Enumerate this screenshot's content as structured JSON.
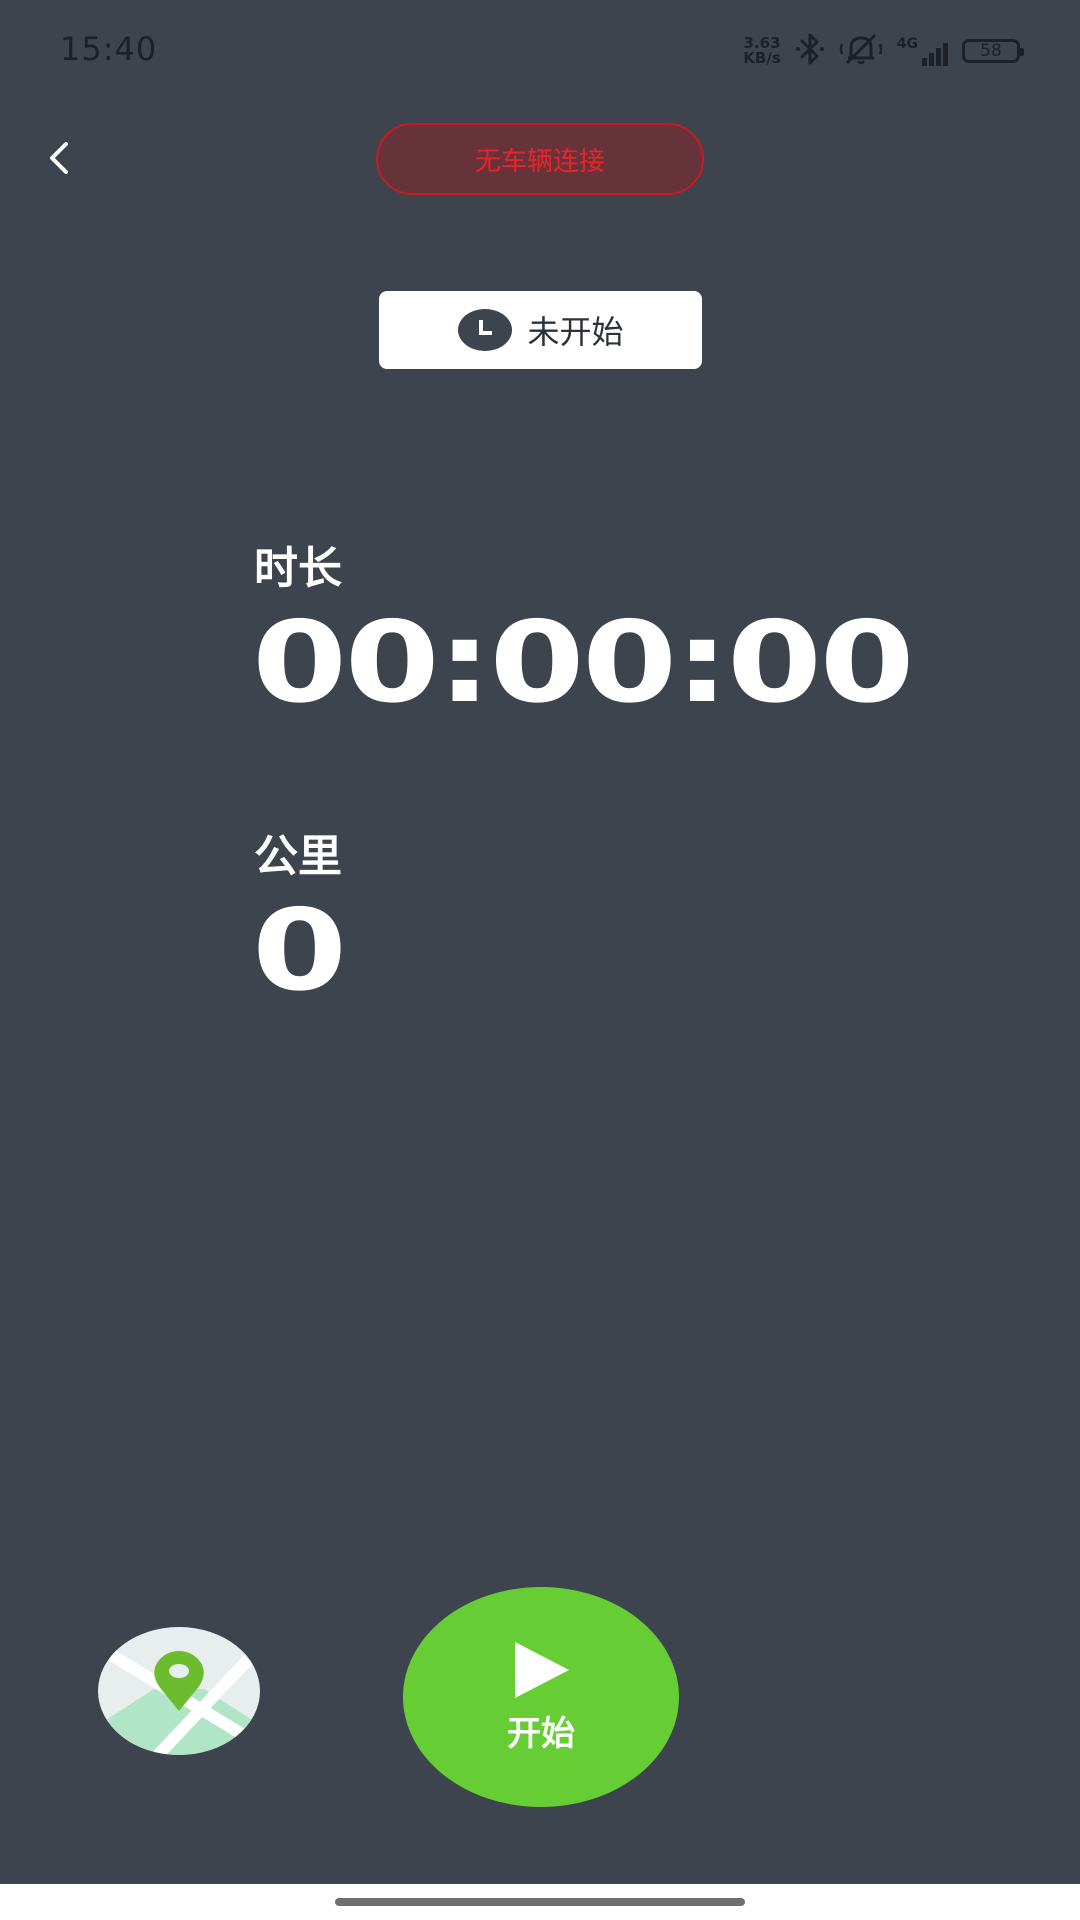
{
  "status_bar": {
    "time": "15:40",
    "net_speed_value": "3.63",
    "net_speed_unit": "KB/s",
    "network_type": "4G",
    "battery_level": "58"
  },
  "header": {
    "connection_status": "无车辆连接",
    "connection_color": "#e8242a"
  },
  "ride_status": {
    "label": "未开始"
  },
  "metrics": {
    "duration_label": "时长",
    "duration_value": "00:00:00",
    "distance_label": "公里",
    "distance_value": "0"
  },
  "controls": {
    "start_label": "开始",
    "start_color": "#67cd34"
  },
  "colors": {
    "background": "#3d444e",
    "accent_green": "#67cd34",
    "warning_red": "#c41c20"
  },
  "icons": {
    "back": "chevron-left-icon",
    "clock": "clock-icon",
    "map": "map-pin-icon",
    "play": "play-icon",
    "bluetooth": "bluetooth-icon",
    "mute": "bell-off-icon"
  }
}
